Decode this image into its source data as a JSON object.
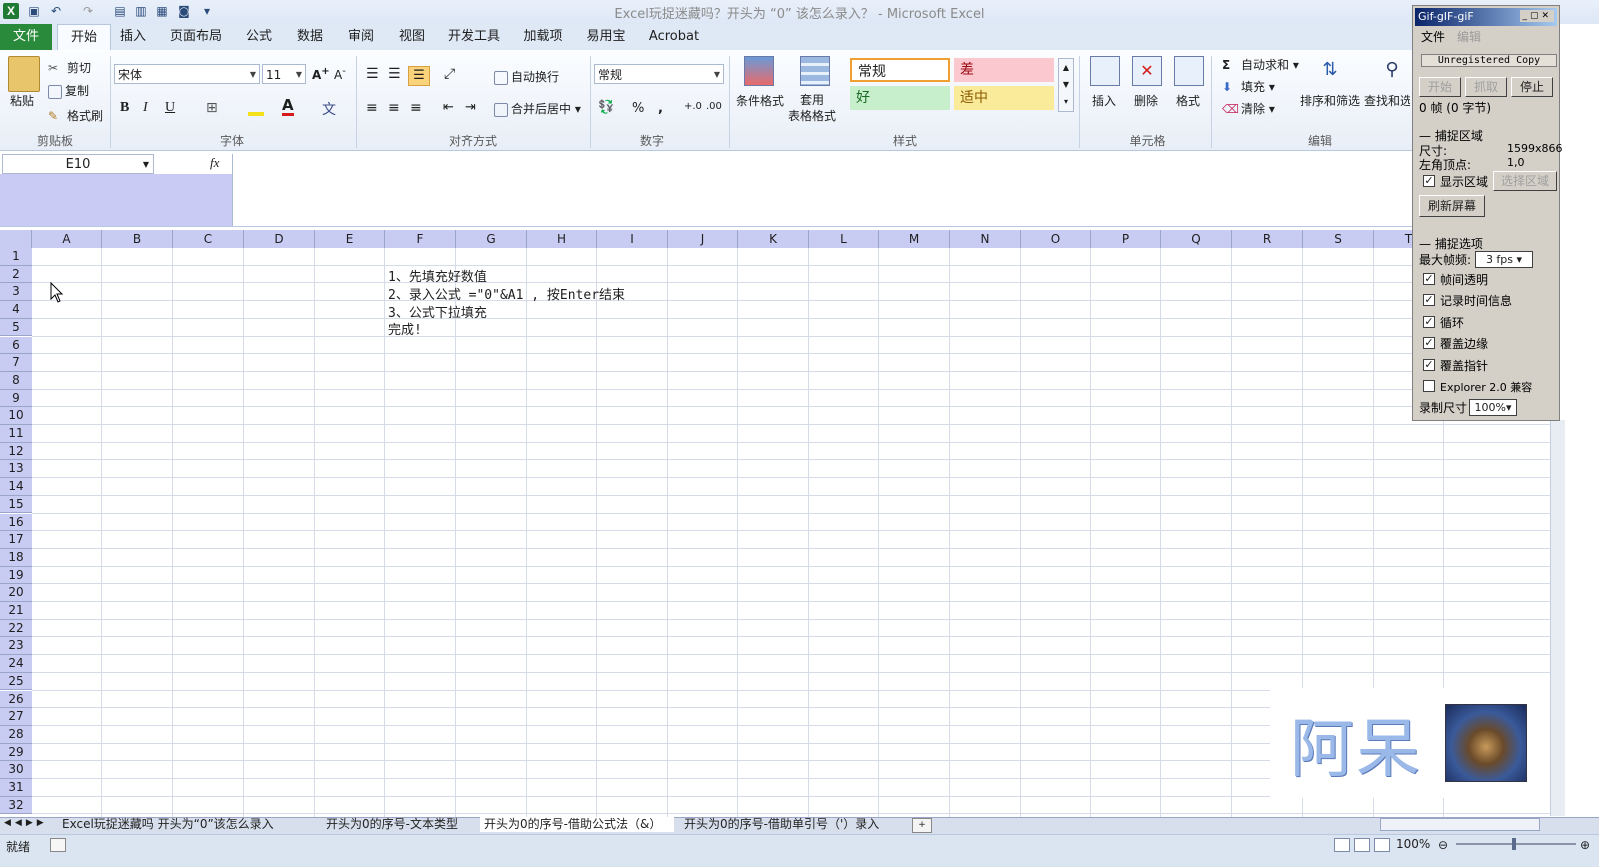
{
  "window": {
    "title": "Excel玩捉迷藏吗？开头为 “0” 该怎么录入？ - Microsoft Excel"
  },
  "ribbon_tabs": [
    "文件",
    "开始",
    "插入",
    "页面布局",
    "公式",
    "数据",
    "审阅",
    "视图",
    "开发工具",
    "加载项",
    "易用宝",
    "Acrobat"
  ],
  "clipboard": {
    "paste": "粘贴",
    "cut": "剪切",
    "copy": "复制",
    "painter": "格式刷",
    "label": "剪贴板"
  },
  "font": {
    "name": "宋体",
    "size": "11",
    "label": "字体",
    "bold": "B",
    "italic": "I",
    "underline": "U"
  },
  "alignment": {
    "wrap": "自动换行",
    "merge": "合并后居中",
    "label": "对齐方式"
  },
  "number": {
    "format": "常规",
    "percent": "%",
    "comma": ",",
    "label": "数字"
  },
  "styles": {
    "cond_format": "条件格式",
    "table_format": "套用\n表格格式",
    "normal": "常规",
    "bad": "差",
    "good": "好",
    "neutral": "适中",
    "label": "样式"
  },
  "cells": {
    "insert": "插入",
    "delete": "删除",
    "format": "格式",
    "label": "单元格"
  },
  "editing": {
    "autosum": "自动求和",
    "fill": "填充",
    "clear": "清除",
    "sort": "排序和筛选",
    "find": "查找和选",
    "label": "编辑"
  },
  "formula_bar": {
    "name_box": "E10",
    "fx": "fx"
  },
  "columns": [
    "A",
    "B",
    "C",
    "D",
    "E",
    "F",
    "G",
    "H",
    "I",
    "J",
    "K",
    "L",
    "M",
    "N",
    "O",
    "P",
    "Q",
    "R",
    "S",
    "T"
  ],
  "rows": [
    "1",
    "2",
    "3",
    "4",
    "5",
    "6",
    "7",
    "8",
    "9",
    "10",
    "11",
    "12",
    "13",
    "14",
    "15",
    "16",
    "17",
    "18",
    "19",
    "20",
    "21",
    "22",
    "23",
    "24",
    "25",
    "26",
    "27",
    "28",
    "29",
    "30",
    "31",
    "32"
  ],
  "cells_content": {
    "F2": "1、先填充好数值",
    "F3": "2、录入公式 =\"0\"&A1 , 按Enter结束",
    "F4": "3、公式下拉填充",
    "F5": "完成!"
  },
  "sheet_tabs": [
    "Excel玩捉迷藏吗 开头为“0”该怎么录入",
    "开头为0的序号-文本类型",
    "开头为0的序号-借助公式法（&）",
    "开头为0的序号-借助单引号（'）录入"
  ],
  "status": {
    "ready": "就绪",
    "zoom": "100%"
  },
  "gif_panel": {
    "title": "Gif-gIF-giF",
    "menu": [
      "文件",
      "编辑"
    ],
    "unregistered": "Unregistered Copy",
    "btn_start": "开始",
    "btn_grab": "抓取",
    "btn_stop": "停止",
    "frames": "0 帧 (0 字节)",
    "capture_area": "捕捉区域",
    "size_label": "尺寸:",
    "size_value": "1599x866",
    "corner_label": "左角顶点:",
    "corner_value": "1,0",
    "show_area": "显示区域",
    "select_area": "选择区域",
    "refresh": "刷新屏幕",
    "capture_options": "捕捉选项",
    "max_fps_label": "最大帧频:",
    "max_fps_value": "3 fps",
    "opt_transparent": "帧间透明",
    "opt_time": "记录时间信息",
    "opt_loop": "循环",
    "opt_edge": "覆盖边缘",
    "opt_pointer": "覆盖指针",
    "opt_explorer": "Explorer 2.0 兼容",
    "rec_size_label": "录制尺寸",
    "rec_size_value": "100%"
  },
  "watermark": {
    "text": "阿呆"
  }
}
